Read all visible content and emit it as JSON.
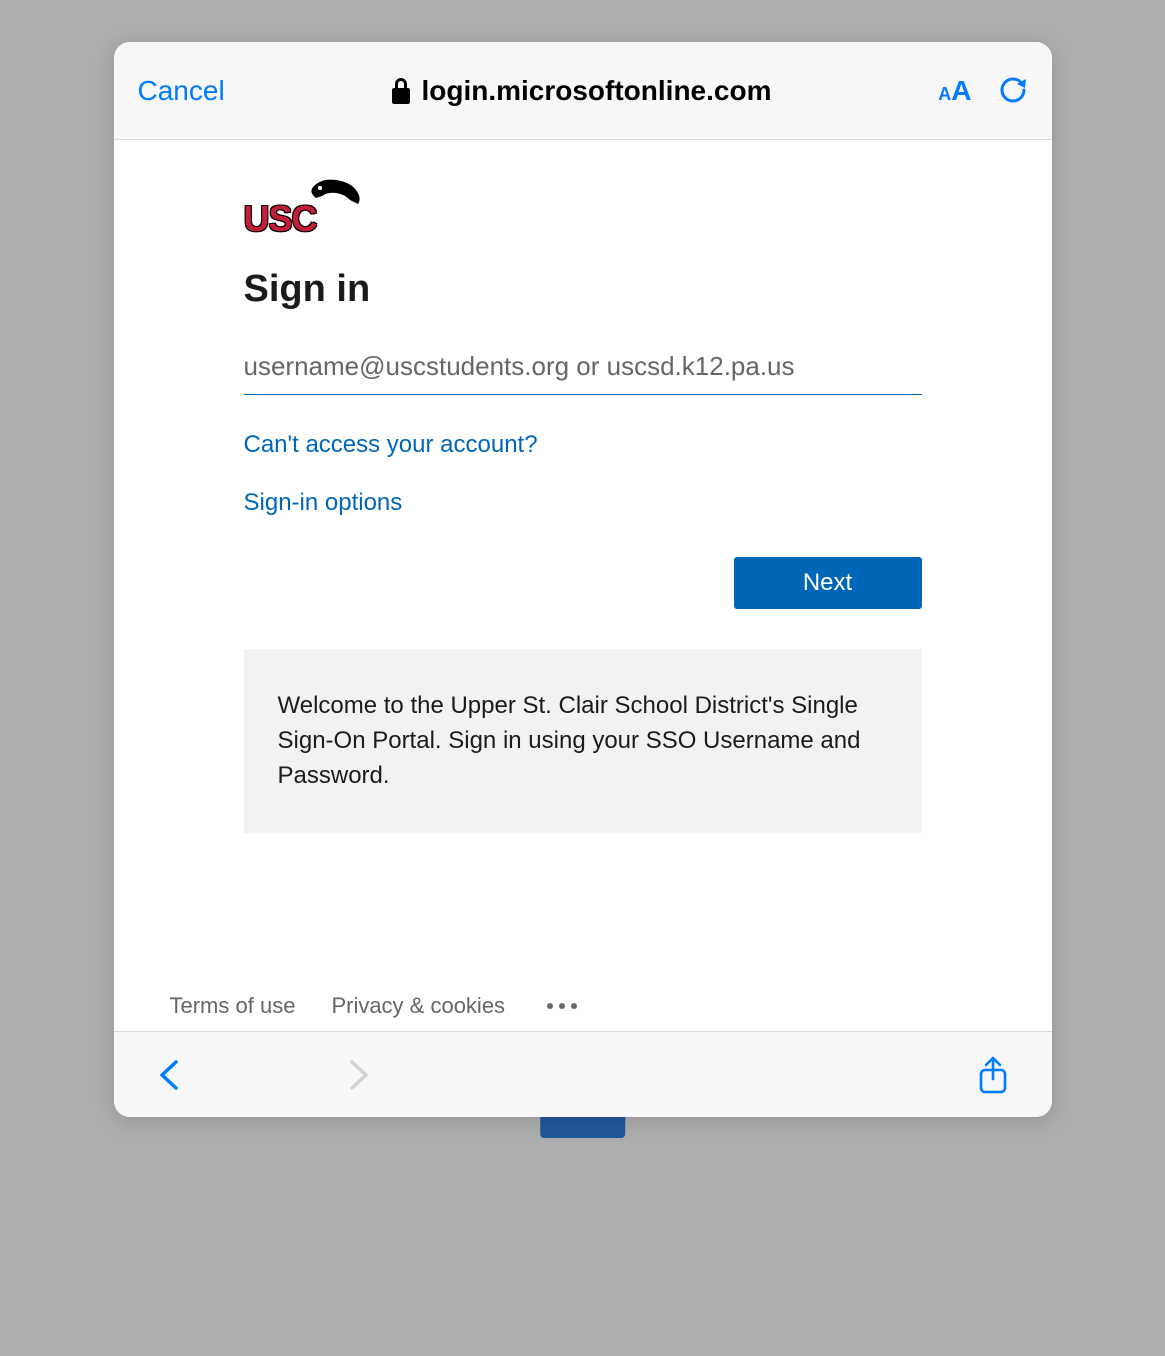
{
  "nav": {
    "cancel_label": "Cancel",
    "url": "login.microsoftonline.com"
  },
  "signin": {
    "logo_text": "USC",
    "heading": "Sign in",
    "placeholder": "username@uscstudents.org or uscsd.k12.pa.us",
    "link_cant_access": "Can't access your account?",
    "link_options": "Sign-in options",
    "next_label": "Next",
    "welcome_text": "Welcome to the Upper St. Clair School District's Single Sign-On Portal. Sign in using your SSO Username and Password."
  },
  "footer": {
    "terms": "Terms of use",
    "privacy": "Privacy & cookies"
  }
}
